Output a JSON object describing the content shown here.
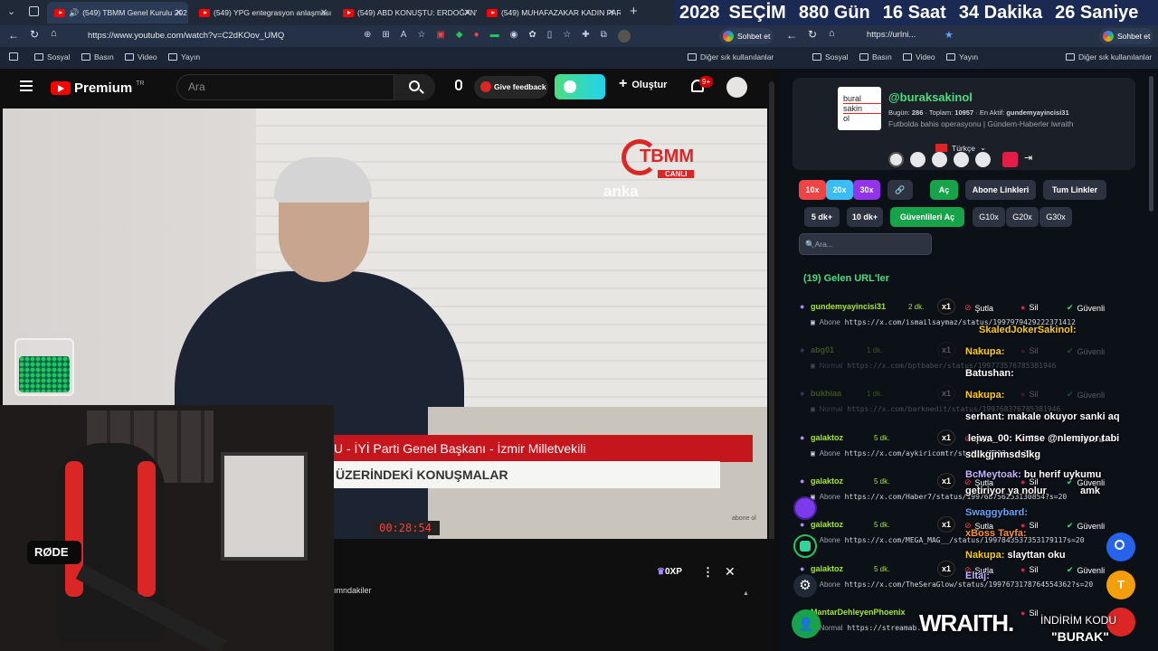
{
  "tabs": [
    {
      "title": "(549) TBMM Genel Kurulu 202",
      "active": true
    },
    {
      "title": "(549) YPG entegrasyon anlaşması",
      "active": false
    },
    {
      "title": "(549) ABD KONUŞTU: ERDOĞAN'I",
      "active": false
    },
    {
      "title": "(549) MUHAFAZAKAR KADIN PART",
      "active": false
    }
  ],
  "countdown": {
    "year": "2028",
    "label": "SEÇİM",
    "days": "880 Gün",
    "hours": "16 Saat",
    "minutes": "34 Dakika",
    "seconds": "26 Saniye"
  },
  "browser": {
    "url": "https://www.youtube.com/watch?v=C2dKOov_UMQ",
    "url2": "https://urlni...",
    "chat_label": "Sohbet et",
    "bookmarks": [
      "Sosyal",
      "Basın",
      "Video",
      "Yayın"
    ],
    "others": "Diğer sık kullanılanlar"
  },
  "youtube": {
    "logo": "Premium",
    "region": "TR",
    "search_placeholder": "Ara",
    "feedback": "Give feedback",
    "create": "Oluştur",
    "notif_count": "9+",
    "overlay_logo": "TBMM",
    "overlay_sub": "CANLI",
    "watermark": "anka",
    "lower_red": "U - İYİ Parti Genel Başkanı - İzmir Milletvekili",
    "lower_white": "ÜZERİNDEKİ KONUŞMALAR",
    "clock": "00:28:54",
    "abone": "abone ol",
    "xp": "0XP",
    "below_text": "ımndakiler"
  },
  "webcam": {
    "mic_brand": "RØDE"
  },
  "profile": {
    "handle": "@buraksakinol",
    "logo_lines": [
      "bural",
      "sakin",
      "ol"
    ],
    "today_label": "Bugün:",
    "today": "286",
    "total_label": "Toplam:",
    "total": "10957",
    "active_label": "En Aktif:",
    "active": "gundemyayincisi31",
    "bio": "Futbolda bahis operasyonu | Gündem-Haberler lwraith",
    "language": "Türkçe"
  },
  "controls": {
    "btn_10x": "10x",
    "btn_20x": "20x",
    "btn_30x": "30x",
    "ac": "Aç",
    "abone": "Abone Linkleri",
    "tum": "Tum Linkler",
    "dk5": "5 dk+",
    "dk10": "10 dk+",
    "guvenli": "Güvenlileri Aç",
    "g10": "G10x",
    "g20": "G20x",
    "g30": "G30x",
    "search_placeholder": "Ara..."
  },
  "urls_title": "(19) Gelen URL'ler",
  "url_rows": [
    {
      "user": "gundemyayincisi31",
      "time": "2 dk.",
      "count": "x1",
      "ban": "Şutla",
      "del": "Sil",
      "safe": "Güvenli",
      "type": "Abone",
      "link": "https://x.com/ismailsaymaz/status/1997979429222371412"
    },
    {
      "user": "abg01",
      "time": "1 dk.",
      "count": "x1",
      "ban": "Şutla",
      "del": "Sil",
      "safe": "Güvenli",
      "type": "Normal",
      "link": "https://x.com/bptbaber/status/199773576785381946"
    },
    {
      "user": "bukhiaa",
      "time": "1 dk.",
      "count": "x1",
      "ban": "Şutla",
      "del": "Sil",
      "safe": "Güvenli",
      "type": "Normal",
      "link": "https://x.com/barknedit/status/199768376785381946"
    },
    {
      "user": "galaktoz",
      "time": "5 dk.",
      "count": "x1",
      "ban": "Şutla",
      "del": "Sil",
      "safe": "Güvenli",
      "type": "Abone",
      "link": "https://x.com/aykiricomtr/status/1997..s=20"
    },
    {
      "user": "galaktoz",
      "time": "5 dk.",
      "count": "x1",
      "ban": "Şutla",
      "del": "Sil",
      "safe": "Güvenli",
      "type": "Abone",
      "link": "https://x.com/Haber7/status/199768756253130854?s=20"
    },
    {
      "user": "galaktoz",
      "time": "5 dk.",
      "count": "x1",
      "ban": "Şutla",
      "del": "Sil",
      "safe": "Güvenli",
      "type": "Abone",
      "link": "https://x.com/MEGA_MAG__/status/1997843537353179117s=20"
    },
    {
      "user": "galaktoz",
      "time": "5 dk.",
      "count": "x1",
      "ban": "Şutla",
      "del": "Sil",
      "safe": "Güvenli",
      "type": "Abone",
      "link": "https://x.com/TheSeraGlow/status/1997673178764554362?s=20"
    },
    {
      "user": "MantarDehleyenPhoenix",
      "time": "",
      "count": "",
      "ban": "",
      "del": "Sil",
      "safe": "",
      "type": "Normal",
      "link": "https://streamab..."
    }
  ],
  "chat": [
    {
      "user": "SkaledJokerSakinol:",
      "msg": "",
      "color": "#facc15"
    },
    {
      "user": "Nakupa:",
      "msg": "",
      "color": "#facc15"
    },
    {
      "user": "Batushan:",
      "msg": "",
      "color": "#ffffff"
    },
    {
      "user": "Nakupa:",
      "msg": "",
      "color": "#facc15"
    },
    {
      "user": "serhant:",
      "msg": "makale okuyor sanki aq",
      "color": "#ffffff"
    },
    {
      "user": "leiwa_00:",
      "msg": "Kimse @nlemiyor tabi",
      "color": "#ffffff"
    },
    {
      "user": "",
      "msg": "sdlkgjnmsdslkg",
      "color": "#ffffff"
    },
    {
      "user": "BcMeytoak:",
      "msg": "bu herif uykumu",
      "color": "#c4b5fd"
    },
    {
      "user": "",
      "msg": "getiriyor ya nolur",
      "color": "#ffffff"
    },
    {
      "user": "Swaggybard:",
      "msg": "",
      "color": "#60a5fa"
    },
    {
      "user": "xBoss Tayfa:",
      "msg": "",
      "color": "#fb923c"
    },
    {
      "user": "Nakupa:",
      "msg": "slayttan oku",
      "color": "#facc15"
    },
    {
      "user": "Eltaj:",
      "msg": "",
      "color": "#c4b5fd"
    }
  ],
  "chat_extra": {
    "amk": "amk"
  },
  "branding": {
    "wraith": "WRAITH.",
    "indirim": "İNDİRİM KODU",
    "burak": "\"BURAK\""
  },
  "colors": {
    "accent_green": "#16a34a",
    "x_red": "#ef4444",
    "x_blue": "#38bdf8",
    "x_purple": "#9333ea",
    "url_user": "#a3e635"
  }
}
